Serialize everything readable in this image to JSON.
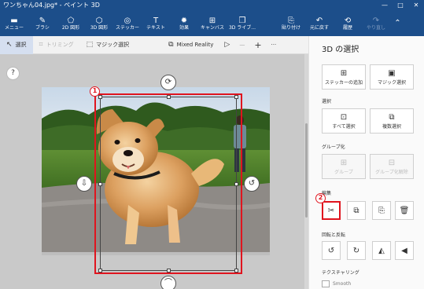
{
  "window": {
    "title": "ワンちゃん04.jpg* - ペイント 3D",
    "controls": [
      "—",
      "□",
      "✕"
    ]
  },
  "ribbon": {
    "items": [
      {
        "label": "メニュー",
        "icon": "menu-icon"
      },
      {
        "label": "ブラシ",
        "icon": "brush-icon"
      },
      {
        "label": "2D 図形",
        "icon": "2d-shapes-icon"
      },
      {
        "label": "3D 図形",
        "icon": "3d-shapes-icon"
      },
      {
        "label": "ステッカー",
        "icon": "sticker-icon"
      },
      {
        "label": "テキスト",
        "icon": "text-icon"
      },
      {
        "label": "効果",
        "icon": "effects-icon"
      },
      {
        "label": "キャンバス",
        "icon": "canvas-icon"
      },
      {
        "label": "3D ライブ...",
        "icon": "3d-library-icon"
      },
      {
        "label": "貼り付け",
        "icon": "paste-icon"
      },
      {
        "label": "元に戻す",
        "icon": "undo-icon"
      },
      {
        "label": "履歴",
        "icon": "history-icon"
      },
      {
        "label": "やり直し",
        "icon": "redo-icon"
      }
    ]
  },
  "toolbar": {
    "select": "選択",
    "crop": "トリミング",
    "magic_select": "マジック選択",
    "mixed_reality": "Mixed Reality",
    "zoom_minus": "—",
    "zoom_plus": "+",
    "more": "···"
  },
  "canvas": {
    "help": "?",
    "badge1": "1",
    "badge2": "2"
  },
  "panel": {
    "title": "3D の選択",
    "sticker_add": "ステッカーの追加",
    "magic_select": "マジック選択",
    "section_select": "選択",
    "select_all": "すべて選択",
    "multi_select": "複数選択",
    "section_group": "グループ化",
    "group": "グループ",
    "ungroup": "グループ化解除",
    "section_edit": "編集",
    "section_rotate": "回転と反転",
    "section_texture": "テクスチャリング",
    "smooth": "Smooth"
  },
  "colors": {
    "accent": "#1c4e8a",
    "highlight": "#e0141e"
  }
}
